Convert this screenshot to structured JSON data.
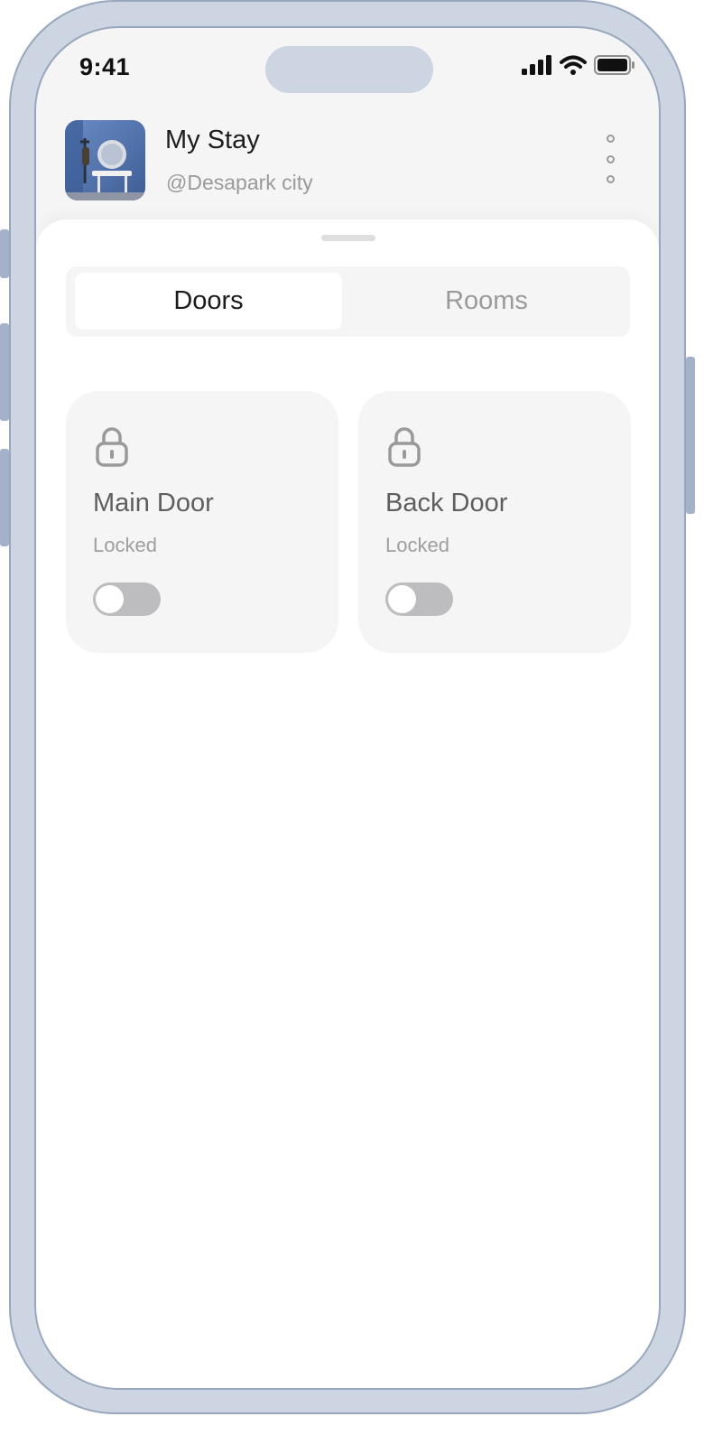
{
  "status_bar": {
    "time": "9:41",
    "icons": [
      "cellular-signal-icon",
      "wifi-icon",
      "battery-icon"
    ]
  },
  "header": {
    "title": "My Stay",
    "subtitle": "@Desapark city",
    "avatar": "property-photo",
    "menu_icon": "more-vertical-icon"
  },
  "tabs": [
    {
      "label": "Doors",
      "selected": true
    },
    {
      "label": "Rooms",
      "selected": false
    }
  ],
  "doors": [
    {
      "name": "Main Door",
      "status": "Locked",
      "icon": "lock-icon",
      "toggle_on": false
    },
    {
      "name": "Back Door",
      "status": "Locked",
      "icon": "lock-icon",
      "toggle_on": false
    }
  ],
  "colors": {
    "frame": "#ccd5e1",
    "frame_border": "#98a7be",
    "screen_bg": "#f5f5f5",
    "card_bg": "#f5f5f5",
    "toggle_off": "#bdbcbe",
    "text_primary": "#1d1d1d",
    "text_secondary": "#9a9a9a"
  }
}
